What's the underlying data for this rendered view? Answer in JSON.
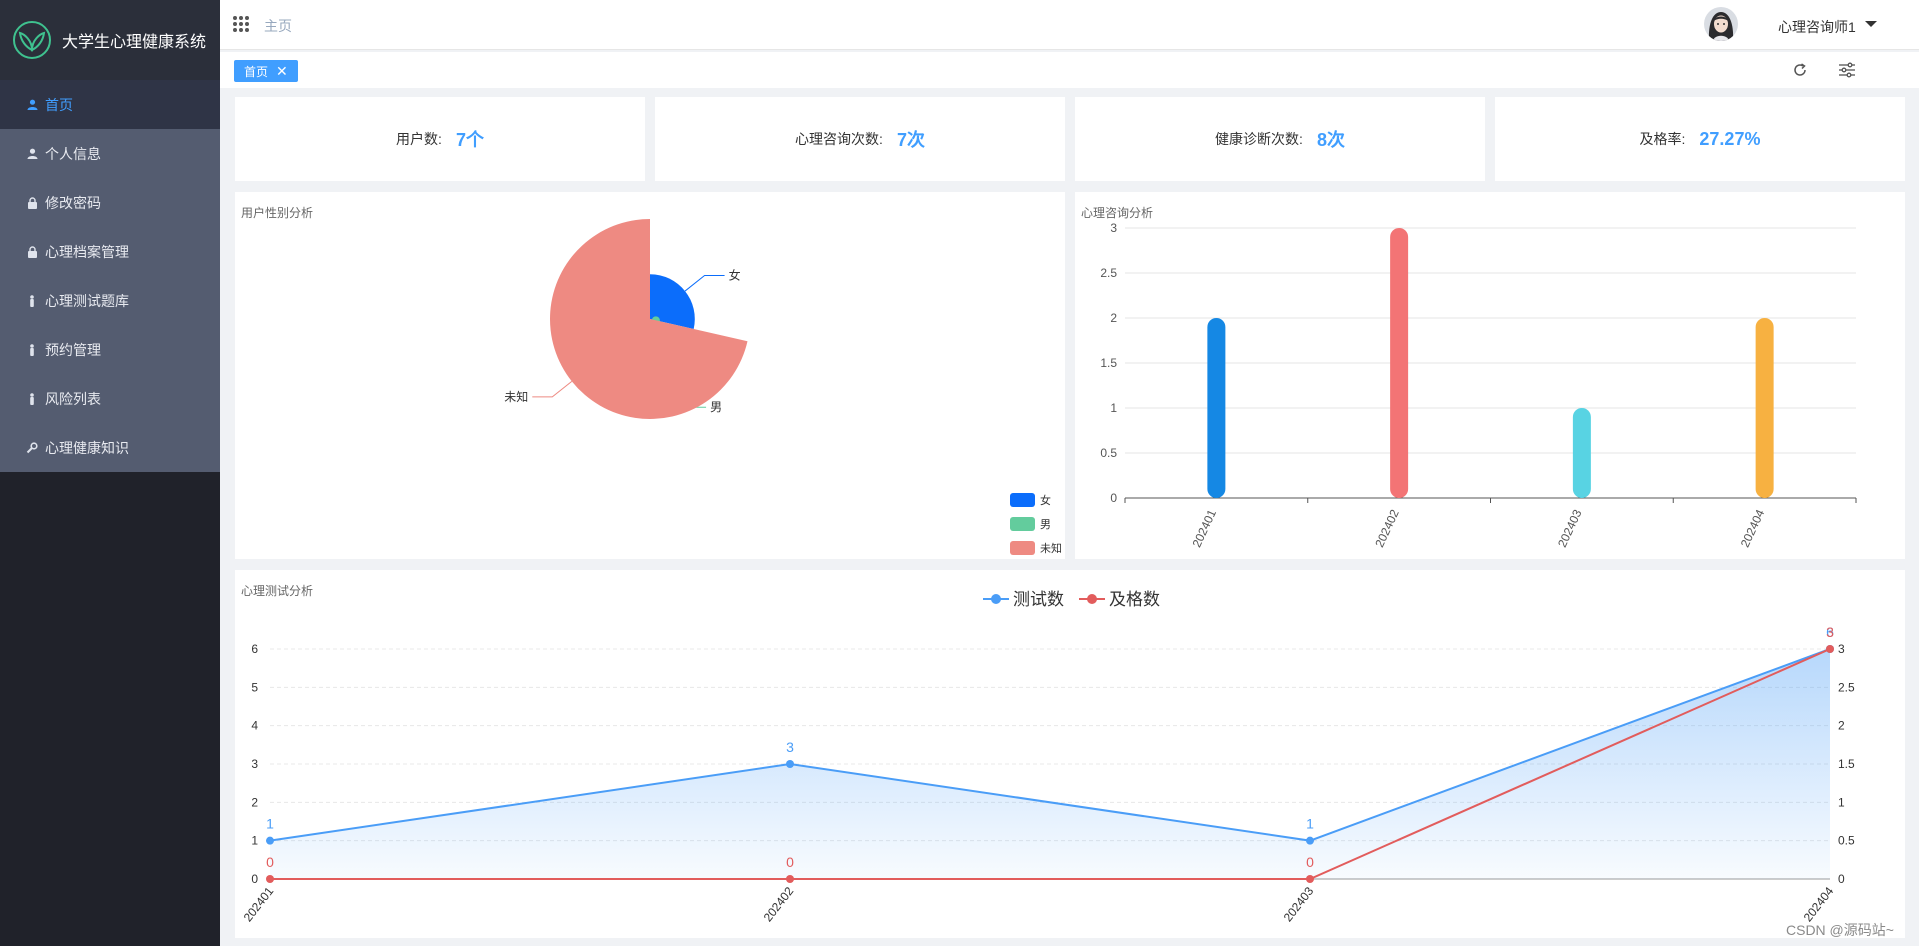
{
  "app": {
    "title": "大学生心理健康系统"
  },
  "sidebar": {
    "items": [
      {
        "label": "首页",
        "icon": "user-icon",
        "active": true
      },
      {
        "label": "个人信息",
        "icon": "user-icon"
      },
      {
        "label": "修改密码",
        "icon": "lock-icon"
      },
      {
        "label": "心理档案管理",
        "icon": "lock-icon"
      },
      {
        "label": "心理测试题库",
        "icon": "person-icon"
      },
      {
        "label": "预约管理",
        "icon": "person-icon"
      },
      {
        "label": "风险列表",
        "icon": "person-icon"
      },
      {
        "label": "心理健康知识",
        "icon": "wrench-icon"
      }
    ]
  },
  "header": {
    "breadcrumb": "主页",
    "username": "心理咨询师1"
  },
  "tags": {
    "home": "首页",
    "close_icon": "close-icon"
  },
  "stats": [
    {
      "label": "用户数:",
      "value": "7个"
    },
    {
      "label": "心理咨询次数:",
      "value": "7次"
    },
    {
      "label": "健康诊断次数:",
      "value": "8次"
    },
    {
      "label": "及格率:",
      "value": "27.27%"
    }
  ],
  "colors": {
    "accent": "#409eff",
    "sidebar_bg": "#20222a",
    "menu_bg": "#545c70"
  },
  "watermark": "CSDN @源码站~",
  "chart_data": [
    {
      "type": "pie",
      "title": "用户性别分析",
      "variant": "rose",
      "labels": [
        "女",
        "男",
        "未知"
      ],
      "values": [
        2,
        0,
        5
      ],
      "colors": [
        "#0b6dfb",
        "#63cc9d",
        "#ee8a82"
      ],
      "legend_position": "bottom-right"
    },
    {
      "type": "bar",
      "title": "心理咨询分析",
      "categories": [
        "202401",
        "202402",
        "202403",
        "202404"
      ],
      "values": [
        2,
        3,
        1,
        2
      ],
      "colors": [
        "#1588e4",
        "#f37475",
        "#58d3e3",
        "#f7b141"
      ],
      "ylim": [
        0,
        3
      ],
      "yticks": [
        "0",
        "0.5",
        "1",
        "1.5",
        "2",
        "2.5",
        "3"
      ],
      "grid": true
    },
    {
      "type": "line",
      "title": "心理测试分析",
      "categories": [
        "202401",
        "202402",
        "202403",
        "202404"
      ],
      "series": [
        {
          "name": "测试数",
          "values": [
            1,
            3,
            1,
            6
          ],
          "color": "#4a9df7",
          "area": true,
          "axis": "left",
          "labels": [
            "1",
            "3",
            "1",
            "6"
          ]
        },
        {
          "name": "及格数",
          "values": [
            0,
            0,
            0,
            3
          ],
          "color": "#e25c5c",
          "axis": "right",
          "labels": [
            "0",
            "0",
            "0",
            "3"
          ]
        }
      ],
      "ylim_left": [
        0,
        6
      ],
      "yticks_left": [
        "0",
        "1",
        "2",
        "3",
        "4",
        "5",
        "6"
      ],
      "ylim_right": [
        0,
        3
      ],
      "yticks_right": [
        "0",
        "0.5",
        "1",
        "1.5",
        "2",
        "2.5",
        "3"
      ],
      "legend_position": "top-center",
      "grid": true
    }
  ]
}
